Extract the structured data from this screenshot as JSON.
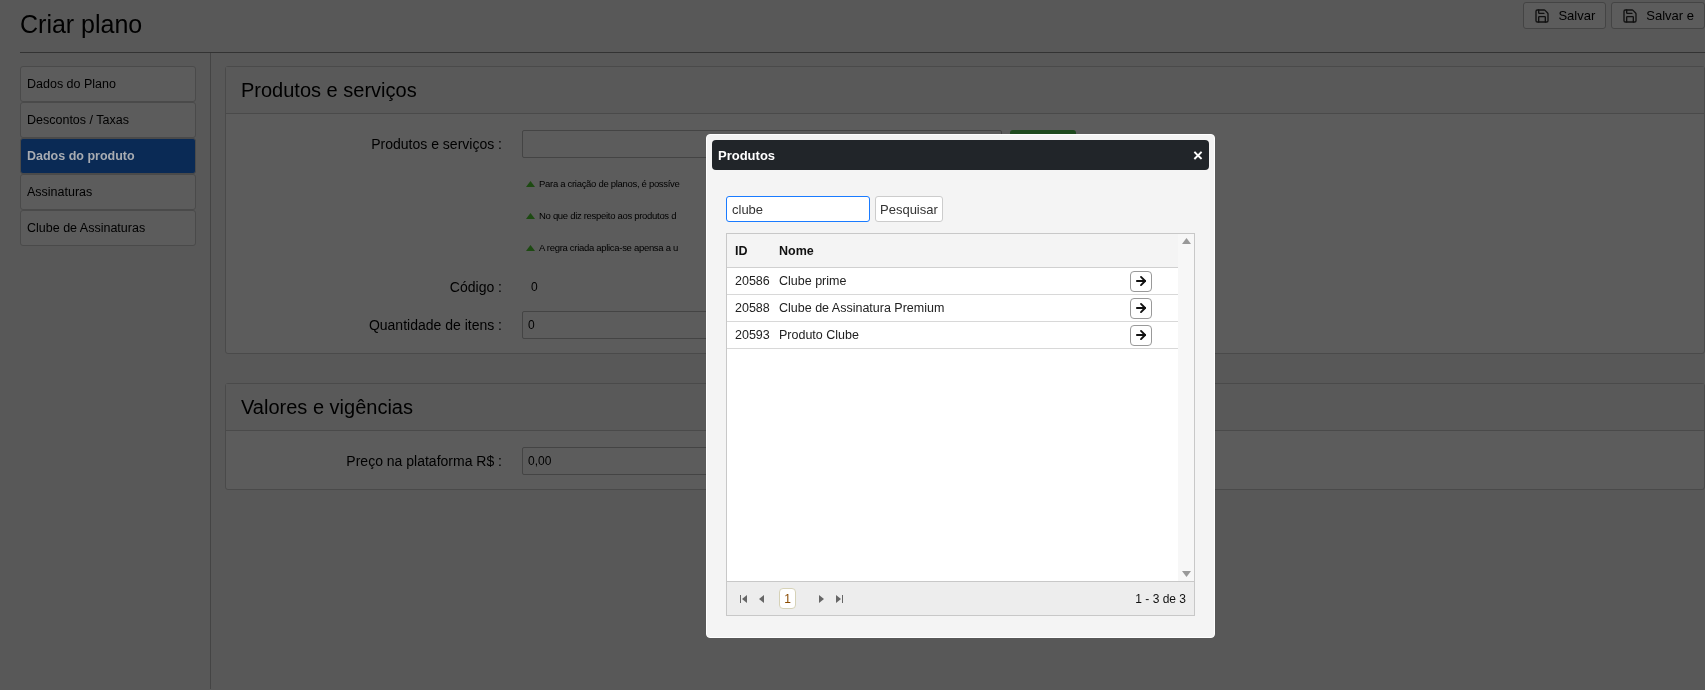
{
  "page": {
    "title": "Criar plano"
  },
  "toolbar": {
    "buttons": [
      {
        "label": "Salvar"
      },
      {
        "label": "Salvar e"
      }
    ]
  },
  "sidebar": {
    "items": [
      {
        "label": "Dados do Plano",
        "selected": false
      },
      {
        "label": "Descontos / Taxas",
        "selected": false
      },
      {
        "label": "Dados do produto",
        "selected": true
      },
      {
        "label": "Assinaturas",
        "selected": false
      },
      {
        "label": "Clube de Assinaturas",
        "selected": false
      }
    ]
  },
  "sections": [
    {
      "title": "Produtos e serviços",
      "rows": [
        {
          "kind": "field",
          "label": "Produtos e serviços :",
          "value": "",
          "button": true
        },
        {
          "kind": "hints",
          "hints": [
            "Para a criação de planos, é possíve",
            "No que diz respeito aos produtos d",
            "A regra criada aplica-se apensa a u"
          ]
        },
        {
          "kind": "text",
          "label": "Código :",
          "value": "0"
        },
        {
          "kind": "field",
          "label": "Quantidade de itens :",
          "value": "0",
          "button": false
        }
      ]
    },
    {
      "title": "Valores e vigências",
      "rows": [
        {
          "kind": "field",
          "label": "Preço na plataforma R$ :",
          "value": "0,00",
          "button": false
        }
      ]
    }
  ],
  "modal": {
    "title": "Produtos",
    "close": "×",
    "search": {
      "value": "clube"
    },
    "search_button": "Pesquisar",
    "table": {
      "columns": [
        "ID",
        "Nome"
      ],
      "rows": [
        {
          "id": "20586",
          "name": "Clube prime"
        },
        {
          "id": "20588",
          "name": "Clube de Assinatura Premium"
        },
        {
          "id": "20593",
          "name": "Produto Clube"
        }
      ]
    },
    "pager": {
      "page": "1",
      "summary": "1 - 3 de 3"
    }
  }
}
